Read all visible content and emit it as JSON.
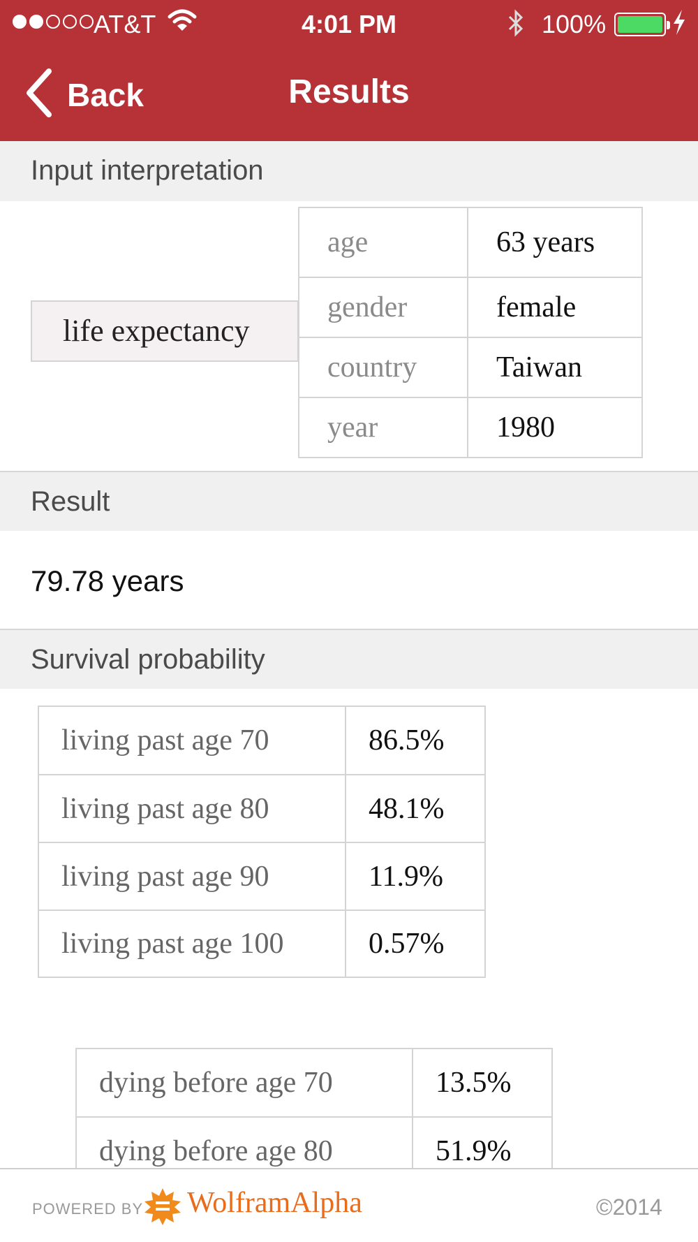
{
  "status_bar": {
    "carrier": "AT&T",
    "time": "4:01 PM",
    "battery": "100%"
  },
  "nav": {
    "back_label": "Back",
    "title": "Results"
  },
  "input_interpretation": {
    "heading": "Input interpretation",
    "query": "life expectancy",
    "rows": [
      {
        "label": "age",
        "value": "63 years"
      },
      {
        "label": "gender",
        "value": "female"
      },
      {
        "label": "country",
        "value": "Taiwan"
      },
      {
        "label": "year",
        "value": "1980"
      }
    ]
  },
  "result": {
    "heading": "Result",
    "value": "79.78 years"
  },
  "survival": {
    "heading": "Survival probability",
    "living": [
      {
        "label": "living past age 70",
        "value": "86.5%"
      },
      {
        "label": "living past age 80",
        "value": "48.1%"
      },
      {
        "label": "living past age 90",
        "value": "11.9%"
      },
      {
        "label": "living past age 100",
        "value": "0.57%"
      }
    ],
    "dying": [
      {
        "label": "dying before age 70",
        "value": "13.5%"
      },
      {
        "label": "dying before age 80",
        "value": "51.9%"
      }
    ]
  },
  "footer": {
    "powered_by": "POWERED BY",
    "brand": "WolframAlpha",
    "copyright": "©2014"
  },
  "colors": {
    "header_red": "#b63236",
    "battery_green": "#4cd964",
    "brand_orange": "#e96c1d"
  }
}
